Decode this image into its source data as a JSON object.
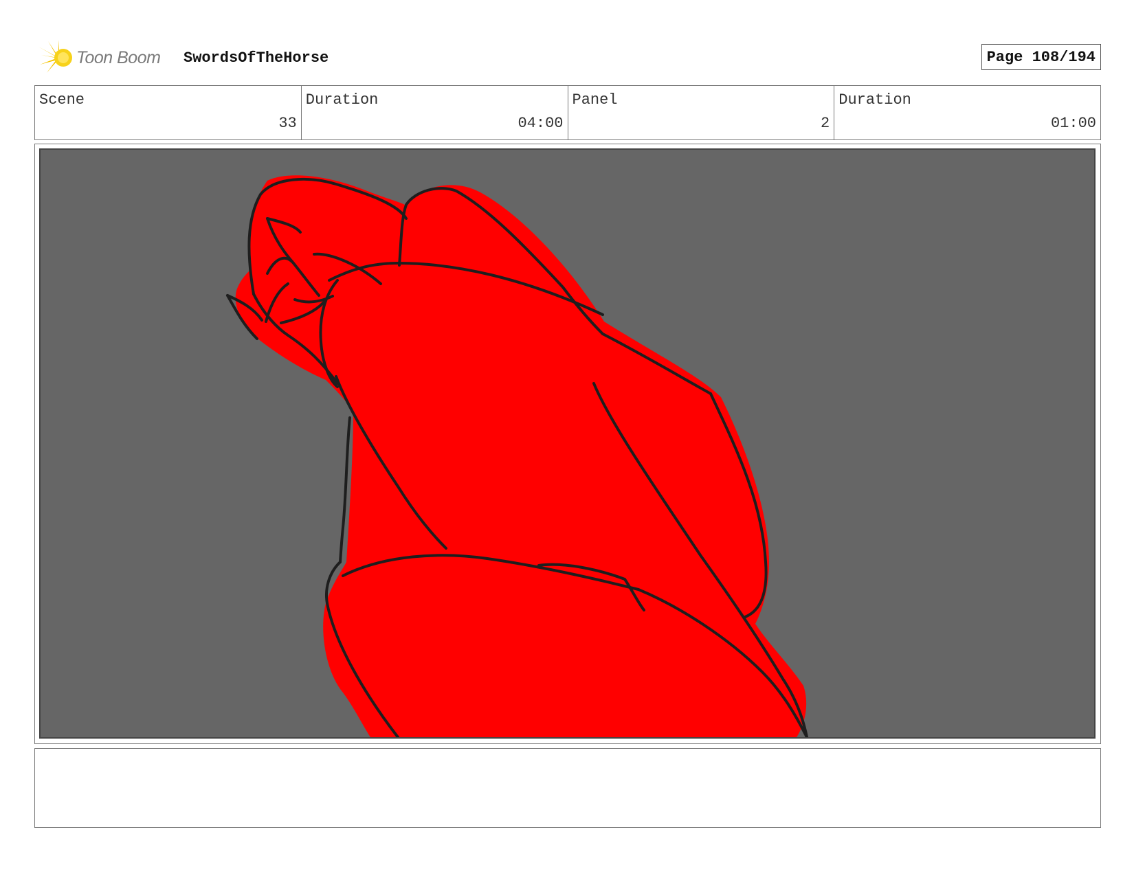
{
  "header": {
    "logo_text": "Toon Boom",
    "project_title": "SwordsOfTheHorse",
    "page_label": "Page 108/194"
  },
  "info": {
    "scene_label": "Scene",
    "scene_value": "33",
    "scene_duration_label": "Duration",
    "scene_duration_value": "04:00",
    "panel_label": "Panel",
    "panel_value": "2",
    "panel_duration_label": "Duration",
    "panel_duration_value": "01:00"
  },
  "panel": {
    "background_color": "#666666",
    "figure_color": "#ff0000",
    "line_color": "#1e1e1e"
  },
  "notes": {
    "text": ""
  }
}
